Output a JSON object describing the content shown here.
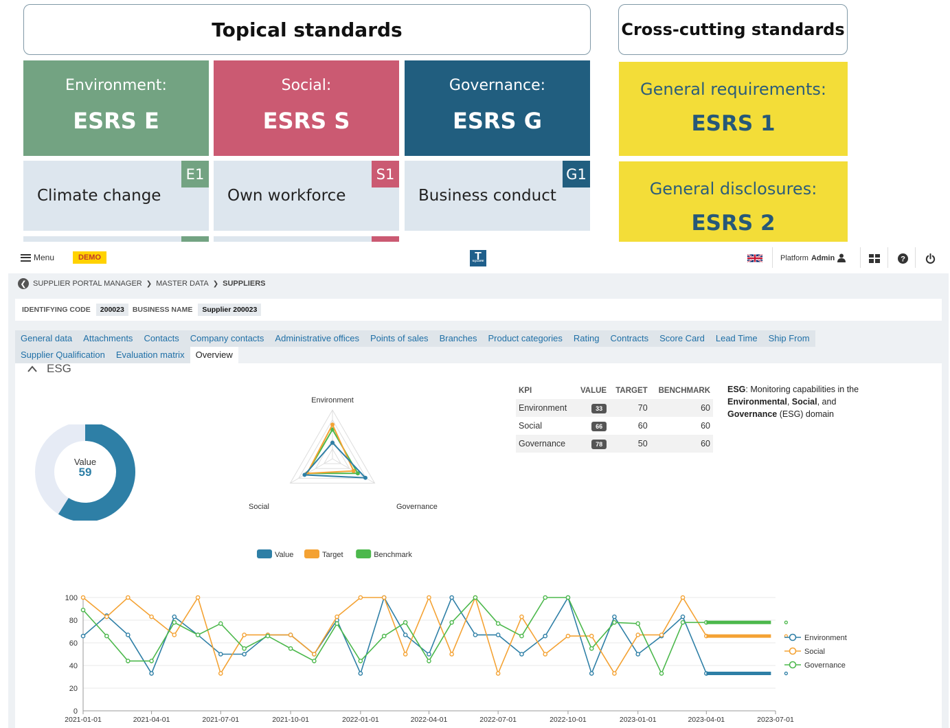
{
  "banner": {
    "topical_title": "Topical standards",
    "cross_title": "Cross-cutting standards",
    "tiles": [
      {
        "category": "Environment:",
        "code": "ESRS E",
        "color": "#73a382"
      },
      {
        "category": "Social:",
        "code": "ESRS S",
        "color": "#cb5a72"
      },
      {
        "category": "Governance:",
        "code": "ESRS G",
        "color": "#215e7f"
      }
    ],
    "subs": [
      {
        "label": "Climate change",
        "tag": "E1",
        "color": "#73a382"
      },
      {
        "label": "Own workforce",
        "tag": "S1",
        "color": "#cb5a72"
      },
      {
        "label": "Business conduct",
        "tag": "G1",
        "color": "#215e7f"
      }
    ],
    "general": [
      {
        "category": "General requirements:",
        "code": "ESRS 1"
      },
      {
        "category": "General disclosures:",
        "code": "ESRS 2"
      }
    ]
  },
  "topbar": {
    "menu_label": "Menu",
    "demo_label": "DEMO",
    "logo_letter": "T",
    "logo_sub": "SQUARE",
    "user_prefix": "Platform",
    "user_name": "Admin"
  },
  "breadcrumb": [
    "SUPPLIER PORTAL MANAGER",
    "MASTER DATA",
    "SUPPLIERS"
  ],
  "identity": {
    "code_label": "IDENTIFYING CODE",
    "code_value": "200023",
    "name_label": "BUSINESS NAME",
    "name_value": "Supplier 200023"
  },
  "tabs": {
    "row1": [
      "General data",
      "Attachments",
      "Contacts",
      "Company contacts",
      "Administrative offices",
      "Points of sales",
      "Branches",
      "Product categories",
      "Rating",
      "Contracts",
      "Score Card",
      "Lead Time",
      "Ship From"
    ],
    "row2": [
      "Supplier Qualification",
      "Evaluation matrix",
      "Overview"
    ],
    "active": "Overview"
  },
  "section": {
    "title": "ESG"
  },
  "gauge": {
    "label": "Value",
    "value": 59,
    "fraction": 0.59,
    "color": "#2e7fa6",
    "track": "#e6ebf5"
  },
  "kpi_table": {
    "headers": [
      "KPI",
      "VALUE",
      "TARGET",
      "BENCHMARK"
    ],
    "rows": [
      {
        "kpi": "Environment",
        "value": "33",
        "target": "70",
        "benchmark": "60"
      },
      {
        "kpi": "Social",
        "value": "66",
        "target": "60",
        "benchmark": "60"
      },
      {
        "kpi": "Governance",
        "value": "78",
        "target": "50",
        "benchmark": "60"
      }
    ]
  },
  "description": {
    "lead": "ESG",
    "p1": ": Monitoring capabilities in the ",
    "b1": "Environmental",
    "p2": ", ",
    "b2": "Social",
    "p3": ", and ",
    "b3": "Governance",
    "p4": " (ESG) domain"
  },
  "chart_data": [
    {
      "type": "radar",
      "axes": [
        "Environment",
        "Governance",
        "Social"
      ],
      "max": 100,
      "series": [
        {
          "name": "Value",
          "color": "#2e7fa6",
          "values": [
            33,
            78,
            66
          ]
        },
        {
          "name": "Target",
          "color": "#f4a233",
          "values": [
            70,
            50,
            60
          ]
        },
        {
          "name": "Benchmark",
          "color": "#4cb84c",
          "values": [
            60,
            60,
            60
          ]
        }
      ],
      "legend_position": "bottom"
    },
    {
      "type": "line",
      "x": [
        "2021-01-01",
        "2021-02-01",
        "2021-03-01",
        "2021-04-01",
        "2021-05-01",
        "2021-06-01",
        "2021-07-01",
        "2021-08-01",
        "2021-09-01",
        "2021-10-01",
        "2021-11-01",
        "2021-12-01",
        "2022-01-01",
        "2022-02-01",
        "2022-03-01",
        "2022-04-01",
        "2022-05-01",
        "2022-06-01",
        "2022-07-01",
        "2022-08-01",
        "2022-09-01",
        "2022-10-01",
        "2022-11-01",
        "2022-12-01",
        "2023-01-01",
        "2023-02-01",
        "2023-03-01",
        "2023-04-01"
      ],
      "x_ticks": [
        "2021-01-01",
        "2021-04-01",
        "2021-07-01",
        "2021-10-01",
        "2022-01-01",
        "2022-04-01",
        "2022-07-01",
        "2022-10-01",
        "2023-01-01",
        "2023-04-01",
        "2023-07-01"
      ],
      "ylim": [
        0,
        100
      ],
      "y_ticks": [
        0,
        20,
        40,
        60,
        80,
        100
      ],
      "series": [
        {
          "name": "Environment",
          "color": "#2e7fa6",
          "values": [
            66,
            84,
            67,
            33,
            83,
            67,
            50,
            50,
            67,
            67,
            50,
            80,
            33,
            100,
            67,
            50,
            100,
            67,
            67,
            50,
            66,
            100,
            33,
            83,
            50,
            66,
            83,
            33
          ],
          "tail_value": 33
        },
        {
          "name": "Social",
          "color": "#f4a233",
          "values": [
            100,
            83,
            100,
            83,
            67,
            100,
            33,
            67,
            67,
            67,
            50,
            83,
            100,
            100,
            50,
            100,
            50,
            100,
            33,
            83,
            50,
            66,
            66,
            33,
            67,
            67,
            100,
            66
          ],
          "tail_value": 66
        },
        {
          "name": "Governance",
          "color": "#4cb84c",
          "values": [
            89,
            66,
            44,
            44,
            78,
            67,
            77,
            55,
            66,
            55,
            44,
            77,
            44,
            66,
            78,
            44,
            78,
            100,
            77,
            66,
            100,
            100,
            55,
            78,
            77,
            33,
            78,
            78
          ],
          "tail_value": 78
        }
      ],
      "legend_position": "right"
    }
  ]
}
